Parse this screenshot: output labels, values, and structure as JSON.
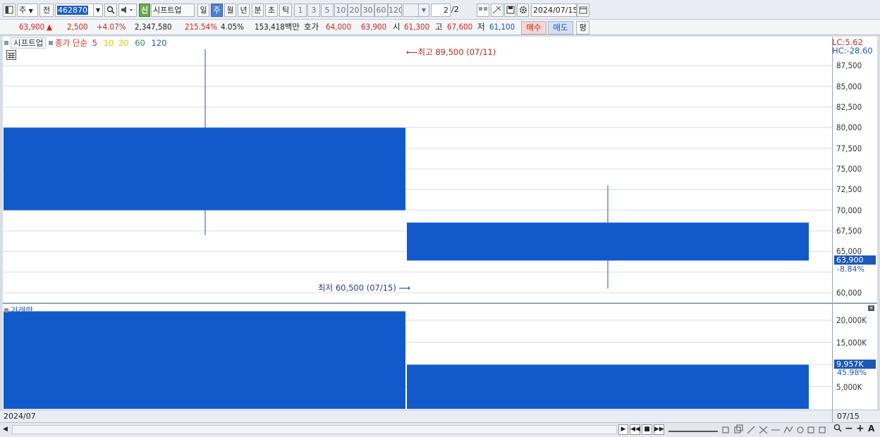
{
  "toolbar": {
    "period_combo": "주",
    "prev_label": "전",
    "stock_code": "462870",
    "sin_label": "신",
    "stock_name": "시프트업",
    "period_buttons": [
      "일",
      "주",
      "월",
      "년",
      "분",
      "초",
      "틱"
    ],
    "selected_period": "주",
    "interval_buttons": [
      "1",
      "3",
      "5",
      "10",
      "20",
      "30",
      "60",
      "120"
    ],
    "page": "2",
    "page_total": "/2",
    "date": "2024/07/15"
  },
  "quote": {
    "price": "63,900",
    "change_arrow": "▲",
    "change": "2,500",
    "change_pct": "+4.07%",
    "volume": "2,347,580",
    "vol_ratio": "215.54%",
    "turnover": "4.05%",
    "amount": "153,418백만",
    "hoga_label": "호가",
    "ask": "64,000",
    "bid": "63,900",
    "open_label": "시",
    "open": "61,300",
    "high_label": "고",
    "high": "67,600",
    "low_label": "저",
    "low": "61,100",
    "buy_label": "매수",
    "sell_label": "매도",
    "eval_label": "평"
  },
  "price_panel": {
    "legend_name": "시프트업",
    "legend_ma_label": "종가 단순",
    "legend_ma": [
      "5",
      "10",
      "20",
      "60",
      "120"
    ],
    "legend_ma_colors": [
      "#d3271b",
      "#f2c500",
      "#f2c500",
      "#2e8b57",
      "#1d57b8"
    ],
    "high_annotation": "최고 89,500 (07/11)",
    "low_annotation": "최저 60,500 (07/15)",
    "lc": "LC:5.62",
    "hc": "HC:-28.60",
    "current_price_label": "63,900",
    "current_pct_label": "-8.84%",
    "y_ticks": [
      "87,500",
      "85,000",
      "82,500",
      "80,000",
      "77,500",
      "75,000",
      "72,500",
      "70,000",
      "67,500",
      "65,000",
      "60,000"
    ]
  },
  "volume_panel": {
    "legend_name": "거래량",
    "y_ticks": [
      "20,000K",
      "15,000K",
      "10,000K",
      "5,000K"
    ],
    "current_label": "9,957K",
    "current_pct": "45.98%"
  },
  "date_axis": {
    "left": "2024/07",
    "right": "07/15"
  },
  "chart_data": {
    "type": "candlestick",
    "colors": {
      "down": "#1259cc",
      "wick": "#1259cc"
    },
    "categories": [
      "2024/07 wk1",
      "07/15"
    ],
    "candles": [
      {
        "open": 80000,
        "close": 70000,
        "high": 89500,
        "low": 67000
      },
      {
        "open": 68500,
        "close": 63900,
        "high": 73000,
        "low": 60500
      }
    ],
    "volume": [
      22000,
      9957
    ],
    "ylim": [
      59000,
      90500
    ],
    "vol_ylim": [
      0,
      22500
    ]
  }
}
